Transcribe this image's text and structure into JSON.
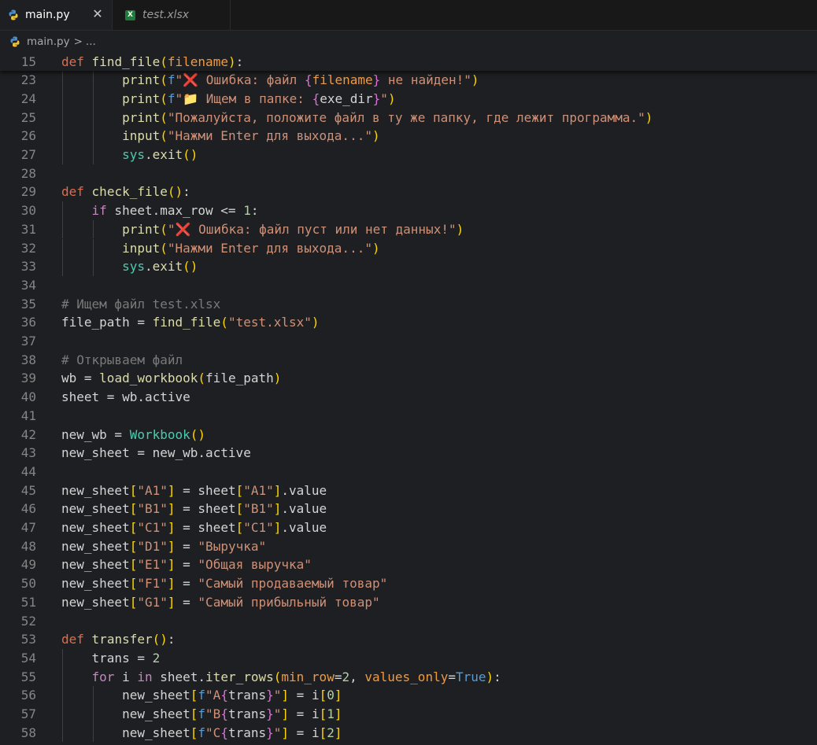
{
  "tabs": [
    {
      "label": "main.py",
      "icon": "python-icon",
      "active": true,
      "close": "✕"
    },
    {
      "label": "test.xlsx",
      "icon": "excel-icon",
      "active": false
    }
  ],
  "breadcrumb": {
    "file": "main.py",
    "separator": ">",
    "rest": "..."
  },
  "colors": {
    "editor_bg": "#1e1f22",
    "keyword": "#c586c0",
    "def_keyword": "#e06c4b",
    "function": "#dcdcaa",
    "string": "#ce9178",
    "comment": "#7a7a7a",
    "bracket_1": "#ffd700",
    "bracket_2": "#da70d6",
    "bracket_3": "#179fff"
  },
  "code_lines": [
    {
      "n": "15",
      "tokens": [
        [
          "def",
          "def"
        ],
        [
          " ",
          "op"
        ],
        [
          "find_file",
          "fn"
        ],
        [
          "(",
          "p1"
        ],
        [
          "filename",
          "param"
        ],
        [
          ")",
          "p1"
        ],
        [
          ":",
          "op"
        ]
      ]
    },
    {
      "n": "23",
      "tokens": [
        [
          "        ",
          "op"
        ],
        [
          "print",
          "fn"
        ],
        [
          "(",
          "p1"
        ],
        [
          "f",
          "builtin"
        ],
        [
          "\"",
          "str"
        ],
        [
          "❌",
          "emoji-red"
        ],
        [
          " Ошибка: файл ",
          "str"
        ],
        [
          "{",
          "p2"
        ],
        [
          "filename",
          "param"
        ],
        [
          "}",
          "p2"
        ],
        [
          " не найден!\"",
          "str"
        ],
        [
          ")",
          "p1"
        ]
      ]
    },
    {
      "n": "24",
      "tokens": [
        [
          "        ",
          "op"
        ],
        [
          "print",
          "fn"
        ],
        [
          "(",
          "p1"
        ],
        [
          "f",
          "builtin"
        ],
        [
          "\"",
          "str"
        ],
        [
          "📁",
          "emoji-folder"
        ],
        [
          " Ищем в папке: ",
          "str"
        ],
        [
          "{",
          "p2"
        ],
        [
          "exe_dir",
          "var"
        ],
        [
          "}",
          "p2"
        ],
        [
          "\"",
          "str"
        ],
        [
          ")",
          "p1"
        ]
      ]
    },
    {
      "n": "25",
      "tokens": [
        [
          "        ",
          "op"
        ],
        [
          "print",
          "fn"
        ],
        [
          "(",
          "p1"
        ],
        [
          "\"Пожалуйста, положите файл в ту же папку, где лежит программа.\"",
          "str"
        ],
        [
          ")",
          "p1"
        ]
      ]
    },
    {
      "n": "26",
      "tokens": [
        [
          "        ",
          "op"
        ],
        [
          "input",
          "fn"
        ],
        [
          "(",
          "p1"
        ],
        [
          "\"Нажми Enter для выхода...\"",
          "str"
        ],
        [
          ")",
          "p1"
        ]
      ]
    },
    {
      "n": "27",
      "tokens": [
        [
          "        ",
          "op"
        ],
        [
          "sys",
          "cls"
        ],
        [
          ".",
          "op"
        ],
        [
          "exit",
          "fn"
        ],
        [
          "()",
          "p1"
        ]
      ]
    },
    {
      "n": "28",
      "tokens": []
    },
    {
      "n": "29",
      "tokens": [
        [
          "def",
          "def"
        ],
        [
          " ",
          "op"
        ],
        [
          "check_file",
          "fn"
        ],
        [
          "()",
          "p1"
        ],
        [
          ":",
          "op"
        ]
      ]
    },
    {
      "n": "30",
      "tokens": [
        [
          "    ",
          "op"
        ],
        [
          "if",
          "kw"
        ],
        [
          " sheet.max_row <= ",
          "var"
        ],
        [
          "1",
          "num"
        ],
        [
          ":",
          "op"
        ]
      ]
    },
    {
      "n": "31",
      "tokens": [
        [
          "        ",
          "op"
        ],
        [
          "print",
          "fn"
        ],
        [
          "(",
          "p1"
        ],
        [
          "\"",
          "str"
        ],
        [
          "❌",
          "emoji-red"
        ],
        [
          " Ошибка: файл пуст или нет данных!\"",
          "str"
        ],
        [
          ")",
          "p1"
        ]
      ]
    },
    {
      "n": "32",
      "tokens": [
        [
          "        ",
          "op"
        ],
        [
          "input",
          "fn"
        ],
        [
          "(",
          "p1"
        ],
        [
          "\"Нажми Enter для выхода...\"",
          "str"
        ],
        [
          ")",
          "p1"
        ]
      ]
    },
    {
      "n": "33",
      "tokens": [
        [
          "        ",
          "op"
        ],
        [
          "sys",
          "cls"
        ],
        [
          ".",
          "op"
        ],
        [
          "exit",
          "fn"
        ],
        [
          "()",
          "p1"
        ]
      ]
    },
    {
      "n": "34",
      "tokens": []
    },
    {
      "n": "35",
      "tokens": [
        [
          "# Ищем файл test.xlsx",
          "cmt"
        ]
      ]
    },
    {
      "n": "36",
      "tokens": [
        [
          "file_path = ",
          "var"
        ],
        [
          "find_file",
          "fn"
        ],
        [
          "(",
          "p1"
        ],
        [
          "\"test.xlsx\"",
          "str"
        ],
        [
          ")",
          "p1"
        ]
      ]
    },
    {
      "n": "37",
      "tokens": []
    },
    {
      "n": "38",
      "tokens": [
        [
          "# Открываем файл",
          "cmt"
        ]
      ]
    },
    {
      "n": "39",
      "tokens": [
        [
          "wb = ",
          "var"
        ],
        [
          "load_workbook",
          "fn"
        ],
        [
          "(",
          "p1"
        ],
        [
          "file_path",
          "var"
        ],
        [
          ")",
          "p1"
        ]
      ]
    },
    {
      "n": "40",
      "tokens": [
        [
          "sheet = wb.active",
          "var"
        ]
      ]
    },
    {
      "n": "41",
      "tokens": []
    },
    {
      "n": "42",
      "tokens": [
        [
          "new_wb = ",
          "var"
        ],
        [
          "Workbook",
          "cls"
        ],
        [
          "()",
          "p1"
        ]
      ]
    },
    {
      "n": "43",
      "tokens": [
        [
          "new_sheet = new_wb.active",
          "var"
        ]
      ]
    },
    {
      "n": "44",
      "tokens": []
    },
    {
      "n": "45",
      "tokens": [
        [
          "new_sheet",
          "var"
        ],
        [
          "[",
          "p1"
        ],
        [
          "\"A1\"",
          "str"
        ],
        [
          "]",
          "p1"
        ],
        [
          " = sheet",
          "var"
        ],
        [
          "[",
          "p1"
        ],
        [
          "\"A1\"",
          "str"
        ],
        [
          "]",
          "p1"
        ],
        [
          ".value",
          "var"
        ]
      ]
    },
    {
      "n": "46",
      "tokens": [
        [
          "new_sheet",
          "var"
        ],
        [
          "[",
          "p1"
        ],
        [
          "\"B1\"",
          "str"
        ],
        [
          "]",
          "p1"
        ],
        [
          " = sheet",
          "var"
        ],
        [
          "[",
          "p1"
        ],
        [
          "\"B1\"",
          "str"
        ],
        [
          "]",
          "p1"
        ],
        [
          ".value",
          "var"
        ]
      ]
    },
    {
      "n": "47",
      "tokens": [
        [
          "new_sheet",
          "var"
        ],
        [
          "[",
          "p1"
        ],
        [
          "\"C1\"",
          "str"
        ],
        [
          "]",
          "p1"
        ],
        [
          " = sheet",
          "var"
        ],
        [
          "[",
          "p1"
        ],
        [
          "\"C1\"",
          "str"
        ],
        [
          "]",
          "p1"
        ],
        [
          ".value",
          "var"
        ]
      ]
    },
    {
      "n": "48",
      "tokens": [
        [
          "new_sheet",
          "var"
        ],
        [
          "[",
          "p1"
        ],
        [
          "\"D1\"",
          "str"
        ],
        [
          "]",
          "p1"
        ],
        [
          " = ",
          "var"
        ],
        [
          "\"Выручка\"",
          "str"
        ]
      ]
    },
    {
      "n": "49",
      "tokens": [
        [
          "new_sheet",
          "var"
        ],
        [
          "[",
          "p1"
        ],
        [
          "\"E1\"",
          "str"
        ],
        [
          "]",
          "p1"
        ],
        [
          " = ",
          "var"
        ],
        [
          "\"Общая выручка\"",
          "str"
        ]
      ]
    },
    {
      "n": "50",
      "tokens": [
        [
          "new_sheet",
          "var"
        ],
        [
          "[",
          "p1"
        ],
        [
          "\"F1\"",
          "str"
        ],
        [
          "]",
          "p1"
        ],
        [
          " = ",
          "var"
        ],
        [
          "\"Самый продаваемый товар\"",
          "str"
        ]
      ]
    },
    {
      "n": "51",
      "tokens": [
        [
          "new_sheet",
          "var"
        ],
        [
          "[",
          "p1"
        ],
        [
          "\"G1\"",
          "str"
        ],
        [
          "]",
          "p1"
        ],
        [
          " = ",
          "var"
        ],
        [
          "\"Самый прибыльный товар\"",
          "str"
        ]
      ]
    },
    {
      "n": "52",
      "tokens": []
    },
    {
      "n": "53",
      "tokens": [
        [
          "def",
          "def"
        ],
        [
          " ",
          "op"
        ],
        [
          "transfer",
          "fn"
        ],
        [
          "()",
          "p1"
        ],
        [
          ":",
          "op"
        ]
      ]
    },
    {
      "n": "54",
      "tokens": [
        [
          "    ",
          "op"
        ],
        [
          "trans = ",
          "var"
        ],
        [
          "2",
          "num"
        ]
      ]
    },
    {
      "n": "55",
      "tokens": [
        [
          "    ",
          "op"
        ],
        [
          "for",
          "kw"
        ],
        [
          " i ",
          "var"
        ],
        [
          "in",
          "kw"
        ],
        [
          " sheet.",
          "var"
        ],
        [
          "iter_rows",
          "fn"
        ],
        [
          "(",
          "p1"
        ],
        [
          "min_row",
          "param"
        ],
        [
          "=",
          "op"
        ],
        [
          "2",
          "num"
        ],
        [
          ", ",
          "op"
        ],
        [
          "values_only",
          "param"
        ],
        [
          "=",
          "op"
        ],
        [
          "True",
          "builtin"
        ],
        [
          ")",
          "p1"
        ],
        [
          ":",
          "op"
        ]
      ]
    },
    {
      "n": "56",
      "tokens": [
        [
          "        ",
          "op"
        ],
        [
          "new_sheet",
          "var"
        ],
        [
          "[",
          "p1"
        ],
        [
          "f",
          "builtin"
        ],
        [
          "\"A",
          "str"
        ],
        [
          "{",
          "p2"
        ],
        [
          "trans",
          "var"
        ],
        [
          "}",
          "p2"
        ],
        [
          "\"",
          "str"
        ],
        [
          "]",
          "p1"
        ],
        [
          " = i",
          "var"
        ],
        [
          "[",
          "p1"
        ],
        [
          "0",
          "num"
        ],
        [
          "]",
          "p1"
        ]
      ]
    },
    {
      "n": "57",
      "tokens": [
        [
          "        ",
          "op"
        ],
        [
          "new_sheet",
          "var"
        ],
        [
          "[",
          "p1"
        ],
        [
          "f",
          "builtin"
        ],
        [
          "\"B",
          "str"
        ],
        [
          "{",
          "p2"
        ],
        [
          "trans",
          "var"
        ],
        [
          "}",
          "p2"
        ],
        [
          "\"",
          "str"
        ],
        [
          "]",
          "p1"
        ],
        [
          " = i",
          "var"
        ],
        [
          "[",
          "p1"
        ],
        [
          "1",
          "num"
        ],
        [
          "]",
          "p1"
        ]
      ]
    },
    {
      "n": "58",
      "tokens": [
        [
          "        ",
          "op"
        ],
        [
          "new_sheet",
          "var"
        ],
        [
          "[",
          "p1"
        ],
        [
          "f",
          "builtin"
        ],
        [
          "\"C",
          "str"
        ],
        [
          "{",
          "p2"
        ],
        [
          "trans",
          "var"
        ],
        [
          "}",
          "p2"
        ],
        [
          "\"",
          "str"
        ],
        [
          "]",
          "p1"
        ],
        [
          " = i",
          "var"
        ],
        [
          "[",
          "p1"
        ],
        [
          "2",
          "num"
        ],
        [
          "]",
          "p1"
        ]
      ]
    }
  ]
}
